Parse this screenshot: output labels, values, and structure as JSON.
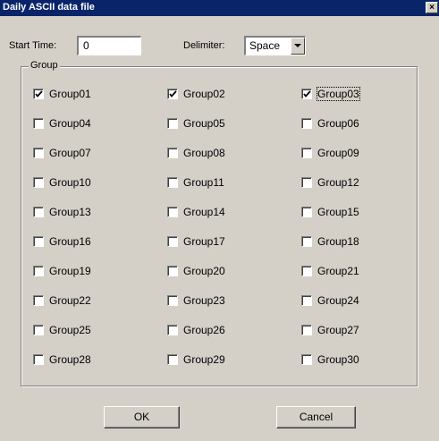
{
  "window": {
    "title": "Daily ASCII data file",
    "close_glyph": "×"
  },
  "start_time": {
    "label": "Start Time:",
    "value": "0"
  },
  "delimiter": {
    "label": "Delimiter:",
    "value": "Space"
  },
  "group_box": {
    "legend": "Group"
  },
  "groups": [
    {
      "label": "Group01",
      "checked": true
    },
    {
      "label": "Group02",
      "checked": true
    },
    {
      "label": "Group03",
      "checked": true
    },
    {
      "label": "Group04",
      "checked": false
    },
    {
      "label": "Group05",
      "checked": false
    },
    {
      "label": "Group06",
      "checked": false
    },
    {
      "label": "Group07",
      "checked": false
    },
    {
      "label": "Group08",
      "checked": false
    },
    {
      "label": "Group09",
      "checked": false
    },
    {
      "label": "Group10",
      "checked": false
    },
    {
      "label": "Group11",
      "checked": false
    },
    {
      "label": "Group12",
      "checked": false
    },
    {
      "label": "Group13",
      "checked": false
    },
    {
      "label": "Group14",
      "checked": false
    },
    {
      "label": "Group15",
      "checked": false
    },
    {
      "label": "Group16",
      "checked": false
    },
    {
      "label": "Group17",
      "checked": false
    },
    {
      "label": "Group18",
      "checked": false
    },
    {
      "label": "Group19",
      "checked": false
    },
    {
      "label": "Group20",
      "checked": false
    },
    {
      "label": "Group21",
      "checked": false
    },
    {
      "label": "Group22",
      "checked": false
    },
    {
      "label": "Group23",
      "checked": false
    },
    {
      "label": "Group24",
      "checked": false
    },
    {
      "label": "Group25",
      "checked": false
    },
    {
      "label": "Group26",
      "checked": false
    },
    {
      "label": "Group27",
      "checked": false
    },
    {
      "label": "Group28",
      "checked": false
    },
    {
      "label": "Group29",
      "checked": false
    },
    {
      "label": "Group30",
      "checked": false
    }
  ],
  "buttons": {
    "ok": "OK",
    "cancel": "Cancel"
  }
}
